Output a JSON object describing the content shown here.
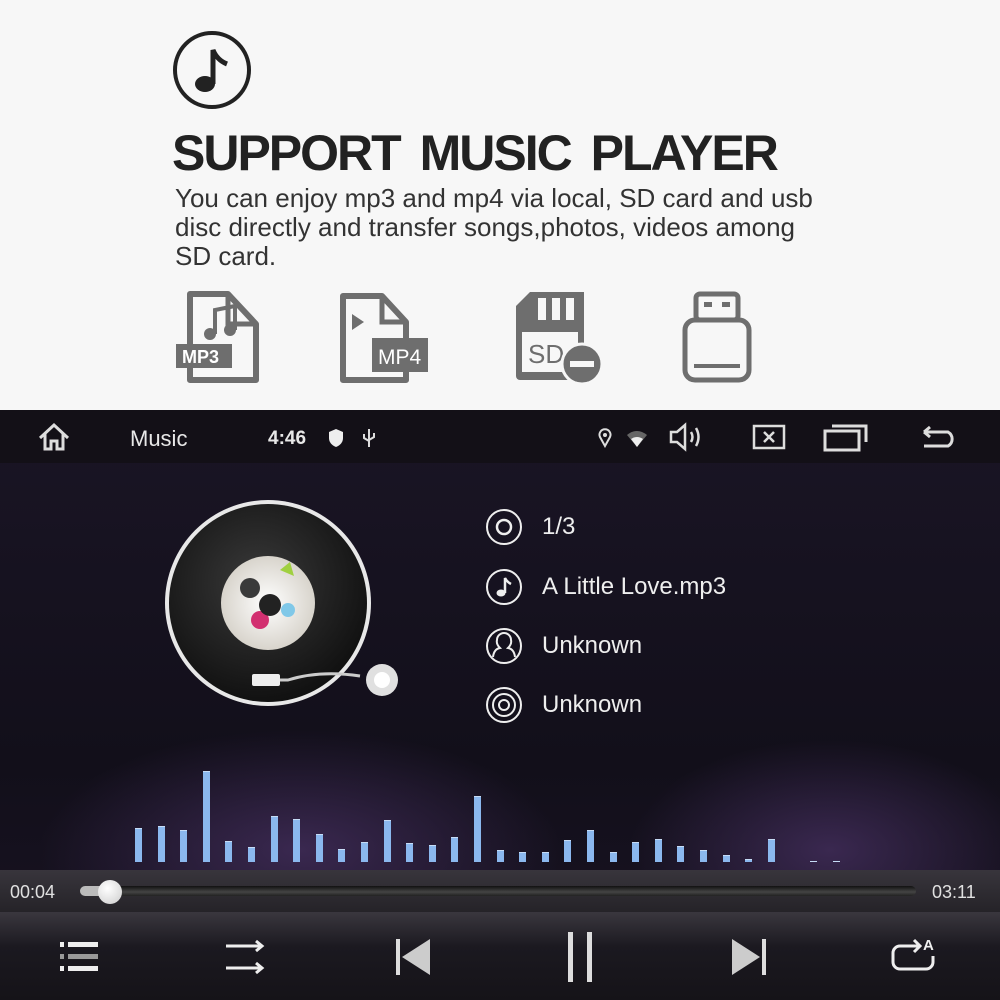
{
  "promo": {
    "title": "SUPPORT  MUSIC PLAYER",
    "description": "You can enjoy mp3 and mp4 via local, SD card and usb disc directly and transfer songs,photos, videos among SD card.",
    "icons": [
      {
        "name": "mp3-file-icon",
        "label": "MP3"
      },
      {
        "name": "mp4-file-icon",
        "label": "MP4"
      },
      {
        "name": "sd-card-icon",
        "label": "SD"
      },
      {
        "name": "usb-drive-icon"
      }
    ],
    "icon_color": "#6e6e6e"
  },
  "status_bar": {
    "app_name": "Music",
    "time": "4:46"
  },
  "track": {
    "index": "1/3",
    "title": "A Little Love.mp3",
    "artist": "Unknown",
    "album": "Unknown"
  },
  "visualizer": {
    "color": "#8bb8ee",
    "levels": [
      34,
      36,
      32,
      91,
      21,
      15,
      46,
      43,
      28,
      13,
      20,
      42,
      19,
      17,
      25,
      66,
      12,
      10,
      10,
      22,
      32,
      10,
      20,
      23,
      16,
      12,
      7,
      3,
      23,
      1,
      1
    ]
  },
  "playback": {
    "elapsed": "00:04",
    "duration": "03:11",
    "progress_percent": 2.1
  }
}
